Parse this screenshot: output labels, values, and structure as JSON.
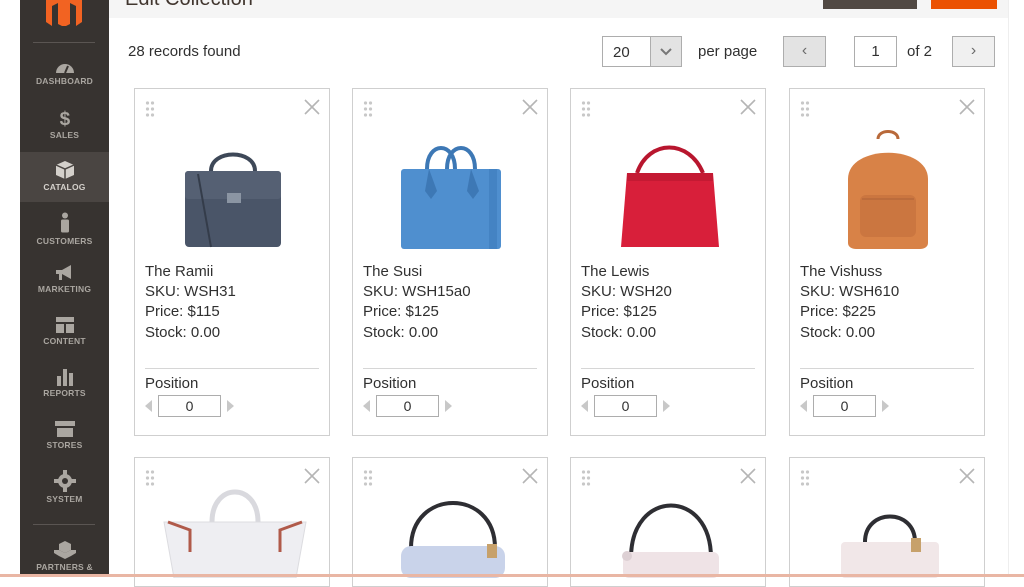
{
  "app": {
    "page_title": "Edit Collection",
    "accent_color": "#eb5202",
    "sidebar_color": "#373330"
  },
  "sidebar": {
    "logo_icon": "magento-logo",
    "items": [
      {
        "label": "DASHBOARD",
        "icon": "dashboard-icon"
      },
      {
        "label": "SALES",
        "icon": "dollar-icon"
      },
      {
        "label": "CATALOG",
        "icon": "box-icon",
        "active": true
      },
      {
        "label": "CUSTOMERS",
        "icon": "person-icon"
      },
      {
        "label": "MARKETING",
        "icon": "megaphone-icon"
      },
      {
        "label": "CONTENT",
        "icon": "layout-icon"
      },
      {
        "label": "REPORTS",
        "icon": "bar-chart-icon"
      },
      {
        "label": "STORES",
        "icon": "store-icon"
      },
      {
        "label": "SYSTEM",
        "icon": "gear-icon"
      },
      {
        "label": "PARTNERS &",
        "icon": "cubes-icon"
      }
    ]
  },
  "toolbar": {
    "records_found": "28 records found",
    "per_page_value": "20",
    "per_page_label": "per page",
    "prev_label": "‹",
    "next_label": "›",
    "page_value": "1",
    "page_of": "of 2"
  },
  "products": [
    {
      "name": "The Ramii",
      "sku": "SKU: WSH31",
      "price": "Price: $115",
      "stock": "Stock: 0.00",
      "position_label": "Position",
      "position": "0",
      "color": "#4a5568"
    },
    {
      "name": "The Susi",
      "sku": "SKU: WSH15a0",
      "price": "Price: $125",
      "stock": "Stock: 0.00",
      "position_label": "Position",
      "position": "0",
      "color": "#4f8fcf"
    },
    {
      "name": "The Lewis",
      "sku": "SKU: WSH20",
      "price": "Price: $125",
      "stock": "Stock: 0.00",
      "position_label": "Position",
      "position": "0",
      "color": "#d81f3a"
    },
    {
      "name": "The Vishuss",
      "sku": "SKU: WSH610",
      "price": "Price: $225",
      "stock": "Stock: 0.00",
      "position_label": "Position",
      "position": "0",
      "color": "#d88247"
    }
  ],
  "products_row2_colors": [
    "#eeeef2",
    "#c9d3ea",
    "#efe3e6",
    "#f1e7e8"
  ]
}
